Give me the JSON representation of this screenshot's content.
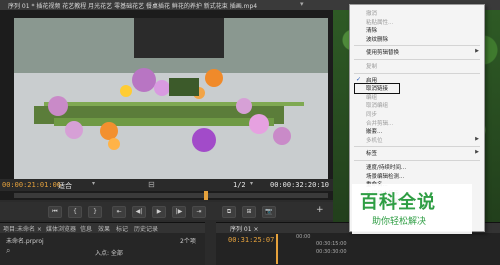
{
  "topbar": {
    "title": "序列 01 * 插花视频 花艺教程 月光花艺 零基础花艺 餐桌插花 鲜花的养护 新式花束 插画.mp4",
    "menu_glyph": "▾"
  },
  "monitor": {
    "tc_left": "00:00:21:01:06",
    "fit_label": "适合",
    "ratio": "1/2",
    "tc_right": "00:00:32:20:10",
    "transport": [
      "⏮",
      "{",
      "}",
      "⇤",
      "◀|",
      "▶",
      "|▶",
      "⇥",
      "⧉",
      "⊞",
      "📷"
    ]
  },
  "project": {
    "tabs": [
      "项目:未命名 ×",
      "媒体浏览器",
      "信息",
      "效果",
      "标记",
      "历史记录"
    ],
    "file": "未命名.prproj",
    "count": "2个项",
    "input_label": "入点: 全部"
  },
  "timeline": {
    "tab": "序列 01 ×",
    "timecode": "00:31:25:07",
    "ruler": [
      "00:00",
      "00:30:15:00",
      "00:30:30:00"
    ]
  },
  "context_menu": {
    "items": [
      {
        "label": "撤消",
        "disabled": true
      },
      {
        "label": "粘贴属性...",
        "disabled": true
      },
      {
        "label": "清除",
        "disabled": false
      },
      {
        "label": "波纹删除",
        "disabled": false
      },
      {
        "label": "sep"
      },
      {
        "label": "使用剪辑替换",
        "disabled": false,
        "submenu": true
      },
      {
        "label": "sep"
      },
      {
        "label": "复制",
        "disabled": true
      },
      {
        "label": "sep"
      },
      {
        "label": "启用",
        "disabled": false,
        "checked": true
      },
      {
        "label": "取消链接",
        "disabled": false,
        "highlight": true
      },
      {
        "label": "编组",
        "disabled": true
      },
      {
        "label": "取消编组",
        "disabled": true
      },
      {
        "label": "同步",
        "disabled": true
      },
      {
        "label": "合并剪辑...",
        "disabled": true
      },
      {
        "label": "嵌套...",
        "disabled": false
      },
      {
        "label": "多机位",
        "disabled": true,
        "submenu": true
      },
      {
        "label": "sep"
      },
      {
        "label": "标签",
        "disabled": false,
        "submenu": true
      },
      {
        "label": "sep"
      },
      {
        "label": "速度/持续时间...",
        "disabled": false
      },
      {
        "label": "场景编辑检测...",
        "disabled": false
      },
      {
        "label": "重命名...",
        "disabled": false
      },
      {
        "label": "在项目中显示",
        "disabled": false
      },
      {
        "label": "在资源管理器中显示",
        "disabled": false
      }
    ]
  },
  "watermark": {
    "logo": "百科全说",
    "sub": "助你轻松解决"
  },
  "colors": {
    "accent": "#e6a23c",
    "brand_green": "#2f9e44"
  }
}
